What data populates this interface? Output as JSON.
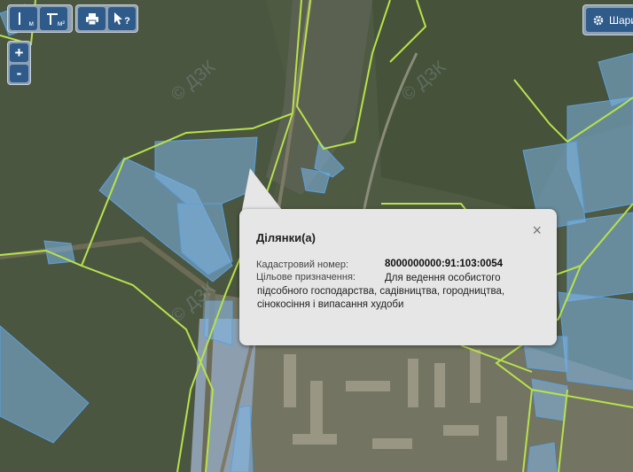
{
  "toolbar": {
    "measure_length_label": "м",
    "measure_area_label": "м²",
    "print_label": "",
    "info_label": "?"
  },
  "zoom": {
    "in_label": "+",
    "out_label": "-"
  },
  "layers": {
    "label": "Шари"
  },
  "popup": {
    "title": "Ділянки(а)",
    "close_label": "×",
    "cadastral_label": "Кадастровий номер:",
    "cadastral_value": "8000000000:91:103:0054",
    "purpose_label": "Цільове призначення:",
    "purpose_value": "Для ведення особистого підсобного господарства, садівництва, городництва, сінокосіння і випасання худоби"
  },
  "watermark": "© ДЗК",
  "colors": {
    "parcel_fill": "#7fb6e6",
    "parcel_stroke": "#5aa0e0",
    "boundary": "#b7e24b",
    "toolbar_button": "#2f5b8a"
  }
}
